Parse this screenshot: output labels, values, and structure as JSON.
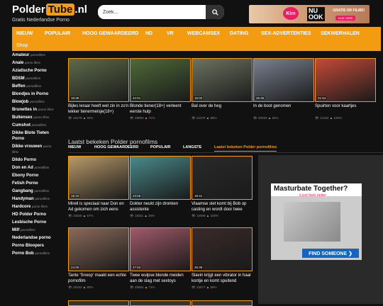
{
  "header": {
    "logo_part1": "Polder",
    "logo_part2": "Tube",
    "logo_part3": ".nl",
    "tagline": "Gratis Nederlandse Porno",
    "search_placeholder": "Zoek...",
    "search_icon": "search-icon"
  },
  "banner": {
    "kim": "Kim",
    "nu_line1": "NU",
    "nu_line2": "OOK",
    "gratis": "GRATIS HD FILMS!",
    "klik": "KLIK HIER!"
  },
  "nav": [
    "NIEUW",
    "POPULAIR",
    "HOOG GEWAARDEERD",
    "HD",
    "VR",
    "WEBCAMSEX",
    "DATING",
    "SEX-ADVERTENTIES",
    "SEKWERHALEN",
    "Shop"
  ],
  "sidebar": [
    {
      "name": "Amateur",
      "tag": "pornofilms"
    },
    {
      "name": "Anale",
      "tag": "porno films"
    },
    {
      "name": "Aziatische Porno",
      "tag": ""
    },
    {
      "name": "BDSM",
      "tag": "pornofilms"
    },
    {
      "name": "Beffen",
      "tag": "pornofilms"
    },
    {
      "name": "Blondjes in Porno",
      "tag": ""
    },
    {
      "name": "Blowjob",
      "tag": "pornofilms"
    },
    {
      "name": "Brunettes in",
      "tag": "porno films"
    },
    {
      "name": "Buitensex",
      "tag": "porno films"
    },
    {
      "name": "Cumshot",
      "tag": "pornofilms"
    },
    {
      "name": "Dikke Blote Tieten Porno",
      "tag": ""
    },
    {
      "name": "Dikke vrouwen",
      "tag": "porno films"
    },
    {
      "name": "Dildo Porno",
      "tag": ""
    },
    {
      "name": "Don en Ad",
      "tag": "pornofilms"
    },
    {
      "name": "Ebony Porno",
      "tag": ""
    },
    {
      "name": "Fetish Porno",
      "tag": ""
    },
    {
      "name": "Gangbang",
      "tag": "pornofilms"
    },
    {
      "name": "Handyman",
      "tag": "pornofilms"
    },
    {
      "name": "Hardcore",
      "tag": "porno films"
    },
    {
      "name": "HD Polder Porno",
      "tag": ""
    },
    {
      "name": "Lesbische Porno",
      "tag": ""
    },
    {
      "name": "Milf",
      "tag": "pornofilms"
    },
    {
      "name": "Nederlandse porno",
      "tag": ""
    },
    {
      "name": "Porno Bloopers",
      "tag": ""
    },
    {
      "name": "Porno Bob",
      "tag": "pornofilms"
    }
  ],
  "top_row": [
    {
      "dur": "18:39",
      "title": "Bijles leraar heeft wel zin in zo'n lekker tienermeisje(18+)",
      "views": "19179",
      "rating": "50%"
    },
    {
      "dur": "24:01",
      "title": "Blonde tiener(18+) verleent eerste hulp",
      "views": "29893",
      "rating": "71%"
    },
    {
      "dur": "15:02",
      "title": "Bal over de heg",
      "views": "42379",
      "rating": "89%"
    },
    {
      "dur": "26:45",
      "title": "In de boot genomen",
      "views": "20033",
      "rating": "84%"
    },
    {
      "dur": "21:54",
      "title": "Spuirten voor kaartjes",
      "views": "14184",
      "rating": "100%"
    }
  ],
  "section_title": "Laatst bekeken Polder pornofilms",
  "tabs": [
    "NIEUW",
    "HOOG GEWAARDEERD",
    "POPULAIR",
    "LANGSTE",
    "Laatst bekeken Polder pornofilms"
  ],
  "grid": [
    {
      "dur": "16:10",
      "title": "Mirell is speciaal naar Don en Ad gekomen om zich eens",
      "views": "23626",
      "rating": "67%"
    },
    {
      "dur": "23:55",
      "title": "Dokter neukt zijn dronken assistente",
      "views": "18311",
      "rating": "46%"
    },
    {
      "dur": "18:41",
      "title": "Vlaamse slet komt bij Bob op casting en wordt door twee",
      "views": "13009",
      "rating": "100%"
    },
    {
      "dur": "24:00",
      "title": "Tante 'Snoop' maakt een echte pornofilm",
      "views": "28153",
      "rating": "80%"
    },
    {
      "dur": "47:53",
      "title": "Twee wulpse blonde meiden aan de slag met sextoys",
      "views": "29854",
      "rating": "71%"
    },
    {
      "dur": "25:39",
      "title": "Slavin krijgt een vibrator in haar kontje en komt spuitend",
      "views": "23577",
      "rating": "59%"
    }
  ],
  "ad": {
    "headline": "Masturbate Together?",
    "sub": "it just feels better",
    "cta": "FIND SOMEONE ❯"
  },
  "colors": {
    "accent": "#f39c12",
    "background": "#111111",
    "ad_cta": "#1565c0"
  }
}
